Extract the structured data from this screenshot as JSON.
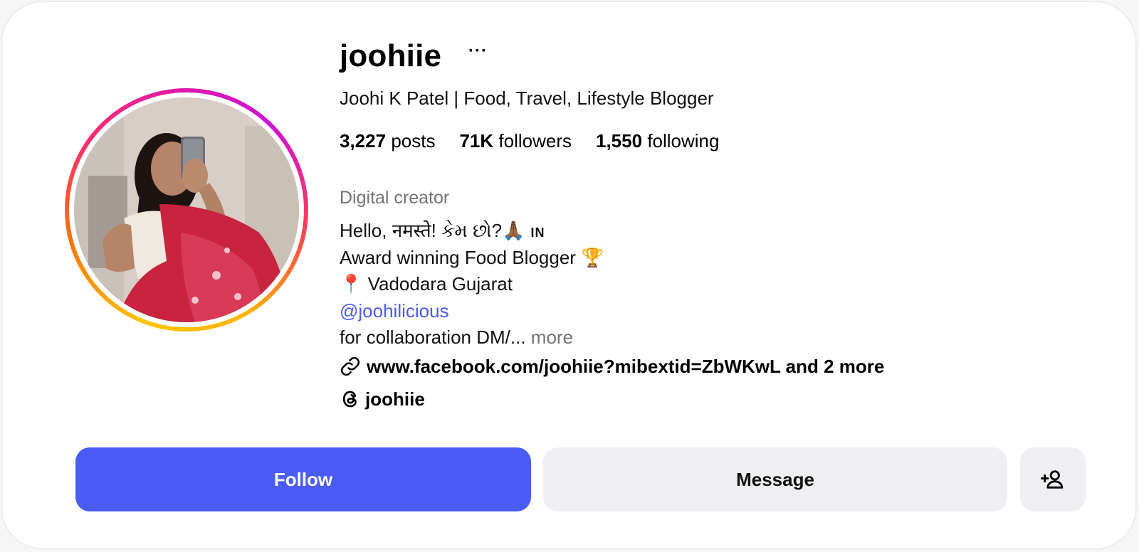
{
  "profile": {
    "username": "joohiie",
    "more_options": "···",
    "full_name": "Joohi K Patel | Food, Travel, Lifestyle Blogger",
    "stats": {
      "posts_count": "3,227",
      "posts_label": "posts",
      "followers_count": "71K",
      "followers_label": "followers",
      "following_count": "1,550",
      "following_label": "following"
    },
    "category": "Digital creator",
    "bio": {
      "line1": "Hello, नमस्ते! કેમ છો?🙏🏾",
      "line1_flag": "IN",
      "line2": "Award winning Food Blogger 🏆",
      "line3": "📍 Vadodara Gujarat",
      "mention": "@joohilicious",
      "line5": "for collaboration DM/...",
      "more_label": "more"
    },
    "link": {
      "icon": "link-icon",
      "text": "www.facebook.com/joohiie?mibextid=ZbWKwL and 2 more"
    },
    "threads": {
      "icon": "threads-icon",
      "handle": "joohiie"
    }
  },
  "actions": {
    "follow_label": "Follow",
    "message_label": "Message",
    "suggest_icon": "add-person-icon"
  },
  "colors": {
    "accent": "#4a5cf5",
    "secondary_button": "#efeff2",
    "muted_text": "#737373"
  }
}
